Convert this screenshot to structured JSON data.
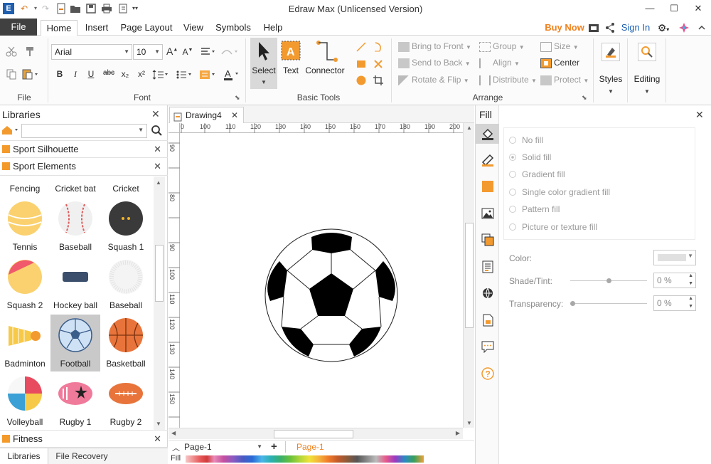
{
  "app": {
    "title": "Edraw Max (Unlicensed Version)",
    "colors": {
      "accent": "#f0821e",
      "file_tab_bg": "#404040",
      "link": "#1a5fb4"
    }
  },
  "quick_access": [
    "app-logo-icon",
    "undo-icon",
    "redo-icon",
    "new-icon",
    "open-icon",
    "save-icon",
    "print-icon",
    "export-icon"
  ],
  "window_controls": {
    "minimize": "—",
    "maximize": "☐",
    "close": "✕"
  },
  "tabs": [
    {
      "label": "File"
    },
    {
      "label": "Home"
    },
    {
      "label": "Insert"
    },
    {
      "label": "Page Layout"
    },
    {
      "label": "View"
    },
    {
      "label": "Symbols"
    },
    {
      "label": "Help"
    }
  ],
  "header_right": {
    "buy_now": "Buy Now",
    "sign_in": "Sign In"
  },
  "ribbon": {
    "groups": {
      "file": "File",
      "font": "Font",
      "basic_tools": "Basic Tools",
      "arrange": "Arrange"
    },
    "font_name": "Arial",
    "font_size": "10",
    "font_grow": "A",
    "font_shrink": "A",
    "format_buttons": [
      "B",
      "I",
      "U",
      "abc",
      "x₂",
      "x²"
    ],
    "font_color_button": "A",
    "tools": {
      "select": "Select",
      "text": "Text",
      "connector": "Connector"
    },
    "arrange": {
      "bring_to_front": "Bring to Front",
      "send_to_back": "Send to Back",
      "rotate_flip": "Rotate & Flip",
      "group": "Group",
      "align": "Align",
      "distribute": "Distribute",
      "size": "Size",
      "center": "Center",
      "protect": "Protect"
    },
    "styles": "Styles",
    "editing": "Editing"
  },
  "libraries": {
    "title": "Libraries",
    "search_value": "",
    "sections": [
      {
        "label": "Sport Silhouette"
      },
      {
        "label": "Sport Elements"
      },
      {
        "label": "Fitness"
      }
    ],
    "shapes": [
      {
        "label": "Fencing"
      },
      {
        "label": "Cricket bat"
      },
      {
        "label": "Cricket"
      },
      {
        "label": "Tennis"
      },
      {
        "label": "Baseball"
      },
      {
        "label": "Squash 1"
      },
      {
        "label": "Squash 2"
      },
      {
        "label": "Hockey ball"
      },
      {
        "label": "Baseball"
      },
      {
        "label": "Badminton"
      },
      {
        "label": "Football"
      },
      {
        "label": "Basketball"
      },
      {
        "label": "Volleyball"
      },
      {
        "label": "Rugby 1"
      },
      {
        "label": "Rugby 2"
      }
    ],
    "selected_shape": "Football",
    "bottom_tabs": [
      "Libraries",
      "File Recovery"
    ]
  },
  "document": {
    "tab_label": "Drawing4",
    "ruler_h": [
      "0",
      "100",
      "110",
      "120",
      "130",
      "140",
      "150",
      "160",
      "170",
      "180",
      "190",
      "200"
    ],
    "ruler_v": [
      "90",
      "80",
      "90",
      "100",
      "110",
      "120",
      "130",
      "140",
      "150"
    ],
    "page_select": "Page-1",
    "active_page": "Page-1",
    "fill_label": "Fill"
  },
  "fill_panel": {
    "title": "Fill",
    "options": [
      {
        "label": "No fill"
      },
      {
        "label": "Solid fill"
      },
      {
        "label": "Gradient fill"
      },
      {
        "label": "Single color gradient fill"
      },
      {
        "label": "Pattern fill"
      },
      {
        "label": "Picture or texture fill"
      }
    ],
    "selected_option": "Solid fill",
    "color_label": "Color:",
    "shade_label": "Shade/Tint:",
    "shade_value": "0 %",
    "shade_level": 0.5,
    "transparency_label": "Transparency:",
    "transparency_value": "0 %",
    "transparency_level": 0
  },
  "side_tools": [
    "fill-icon",
    "line-icon",
    "shadow-icon",
    "image-icon",
    "layer-icon",
    "page-icon",
    "hyperlink-icon",
    "attachment-icon",
    "comment-icon",
    "help-icon"
  ]
}
